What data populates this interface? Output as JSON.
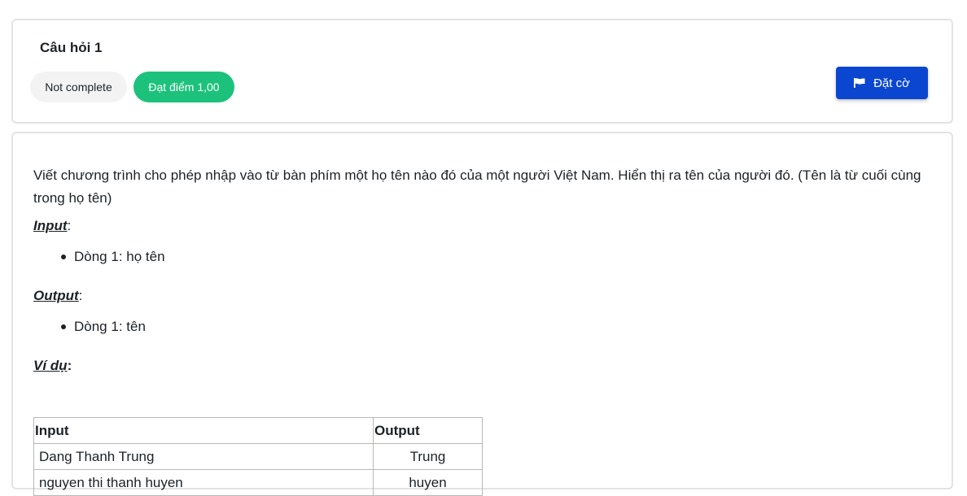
{
  "question": {
    "title": "Câu hỏi 1",
    "status": "Not complete",
    "grade": "Đạt điểm 1,00",
    "flag_label": "Đặt cờ"
  },
  "colors": {
    "grade_badge": "#1cc27b",
    "flag_button": "#0b46d1",
    "status_badge": "#f3f3f3"
  },
  "content": {
    "description": "Viết chương trình cho phép nhập vào từ bàn phím một họ tên nào đó của một người Việt Nam. Hiển thị ra tên của người đó. (Tên là từ cuối cùng trong họ tên)",
    "input_label": "Input",
    "input_items": [
      "Dòng 1: họ tên"
    ],
    "output_label": "Output",
    "output_items": [
      "Dòng 1: tên"
    ],
    "example_label": "Ví dụ",
    "colon": ":",
    "example_table": {
      "headers": [
        "Input",
        "Output"
      ],
      "rows": [
        [
          "Dang Thanh Trung",
          "Trung"
        ],
        [
          "nguyen thi thanh huyen",
          "huyen"
        ]
      ]
    }
  }
}
